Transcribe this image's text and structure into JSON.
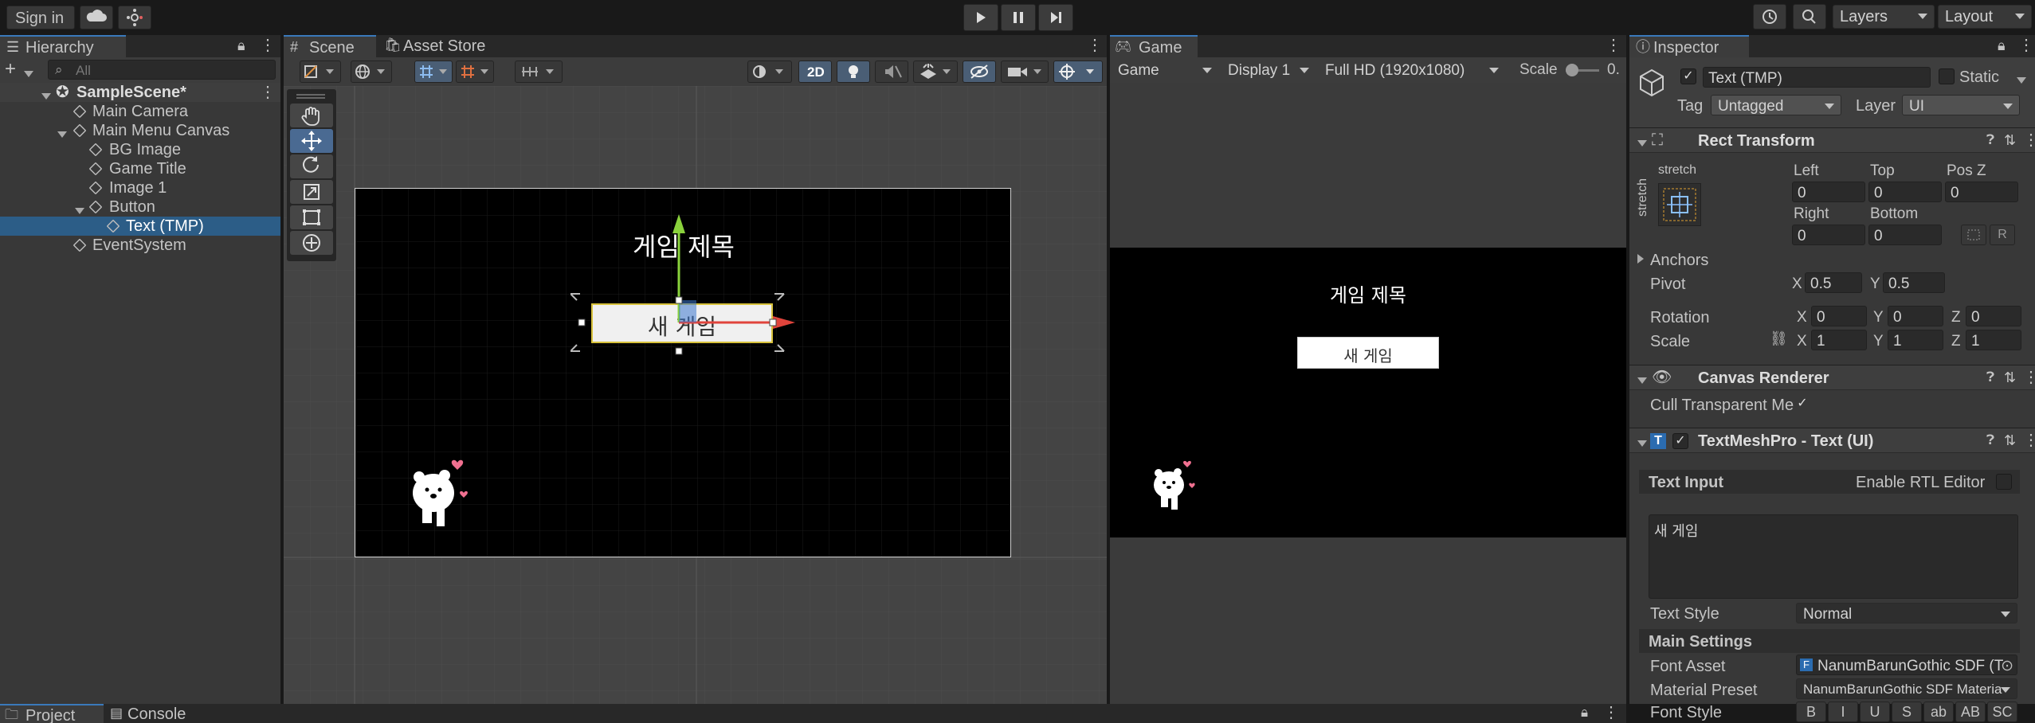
{
  "toolbar": {
    "sign_in": "Sign in",
    "layers": "Layers",
    "layout": "Layout"
  },
  "hierarchy": {
    "tab": "Hierarchy",
    "search_placeholder": "All",
    "items": [
      {
        "label": "SampleScene*"
      },
      {
        "label": "Main Camera"
      },
      {
        "label": "Main Menu Canvas"
      },
      {
        "label": "BG Image"
      },
      {
        "label": "Game Title"
      },
      {
        "label": "Image 1"
      },
      {
        "label": "Button"
      },
      {
        "label": "Text (TMP)"
      },
      {
        "label": "EventSystem"
      }
    ]
  },
  "scene": {
    "tab": "Scene",
    "asset_store_tab": "Asset Store",
    "mode_2d": "2D",
    "title_text": "게임 제목",
    "button_text": "새 게임"
  },
  "game": {
    "tab": "Game",
    "display_mode": "Game",
    "display": "Display 1",
    "resolution": "Full HD (1920x1080)",
    "scale_label": "Scale",
    "scale_value": "0.",
    "title_text": "게임 제목",
    "button_text": "새 게임"
  },
  "inspector": {
    "tab": "Inspector",
    "object_name": "Text (TMP)",
    "static_label": "Static",
    "tag_label": "Tag",
    "tag_value": "Untagged",
    "layer_label": "Layer",
    "layer_value": "UI",
    "rect_transform": {
      "title": "Rect Transform",
      "stretch_top": "stretch",
      "stretch_side": "stretch",
      "left_label": "Left",
      "left": "0",
      "top_label": "Top",
      "top": "0",
      "posz_label": "Pos Z",
      "posz": "0",
      "right_label": "Right",
      "right": "0",
      "bottom_label": "Bottom",
      "bottom": "0",
      "anchors": "Anchors",
      "pivot": "Pivot",
      "pivot_x": "0.5",
      "pivot_y": "0.5",
      "rotation": "Rotation",
      "rot_x": "0",
      "rot_y": "0",
      "rot_z": "0",
      "scale": "Scale",
      "scale_x": "1",
      "scale_y": "1",
      "scale_z": "1",
      "btn_r": "R"
    },
    "canvas_renderer": {
      "title": "Canvas Renderer",
      "cull": "Cull Transparent Me"
    },
    "tmp": {
      "title": "TextMeshPro - Text (UI)",
      "text_input": "Text Input",
      "enable_rtl": "Enable RTL Editor",
      "text_value": "새 게임",
      "text_style_label": "Text Style",
      "text_style": "Normal",
      "main_settings": "Main Settings",
      "font_asset_label": "Font Asset",
      "font_asset": "NanumBarunGothic SDF (T",
      "material_preset_label": "Material Preset",
      "material_preset": "NanumBarunGothic SDF Materia",
      "font_style_label": "Font Style",
      "font_styles": [
        "B",
        "I",
        "U",
        "S",
        "ab",
        "AB",
        "SC"
      ]
    },
    "axis": {
      "x": "X",
      "y": "Y",
      "z": "Z"
    }
  },
  "bottom": {
    "project": "Project",
    "console": "Console"
  },
  "colors": {
    "accent": "#3a79bb",
    "selection": "#2c5d87",
    "bg": "#383838"
  }
}
